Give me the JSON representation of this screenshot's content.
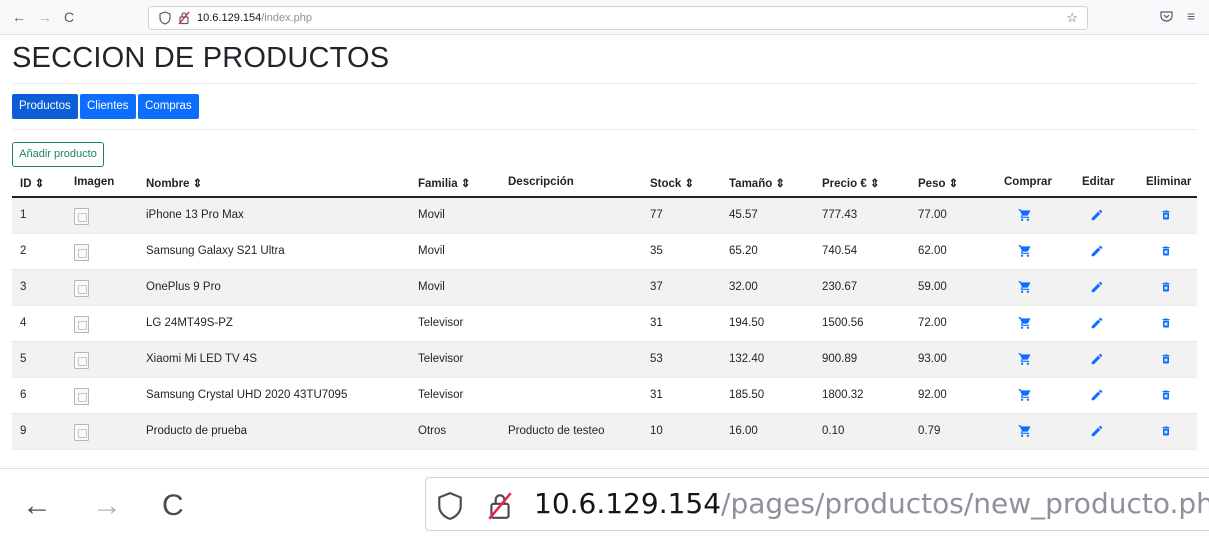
{
  "browser": {
    "back": "←",
    "forward": "→",
    "reload": "C",
    "url_host": "10.6.129.154",
    "url_path": "/index.php",
    "bookmark": "☆",
    "menu": "≡"
  },
  "page": {
    "title": "SECCION DE PRODUCTOS"
  },
  "nav": [
    {
      "label": "Productos",
      "active": true
    },
    {
      "label": "Clientes",
      "active": false
    },
    {
      "label": "Compras",
      "active": false
    }
  ],
  "add_button": "Añadir producto",
  "table": {
    "headers": [
      "ID ⇕",
      "Imagen",
      "Nombre ⇕",
      "Familia ⇕",
      "Descripción",
      "Stock ⇕",
      "Tamaño ⇕",
      "Precio € ⇕",
      "Peso ⇕",
      "Comprar",
      "Editar",
      "Eliminar"
    ],
    "rows": [
      {
        "id": "1",
        "nombre": "iPhone 13 Pro Max",
        "familia": "Movil",
        "descripcion": "",
        "stock": "77",
        "tamano": "45.57",
        "precio": "777.43",
        "peso": "77.00"
      },
      {
        "id": "2",
        "nombre": "Samsung Galaxy S21 Ultra",
        "familia": "Movil",
        "descripcion": "",
        "stock": "35",
        "tamano": "65.20",
        "precio": "740.54",
        "peso": "62.00"
      },
      {
        "id": "3",
        "nombre": "OnePlus 9 Pro",
        "familia": "Movil",
        "descripcion": "",
        "stock": "37",
        "tamano": "32.00",
        "precio": "230.67",
        "peso": "59.00"
      },
      {
        "id": "4",
        "nombre": "LG 24MT49S-PZ",
        "familia": "Televisor",
        "descripcion": "",
        "stock": "31",
        "tamano": "194.50",
        "precio": "1500.56",
        "peso": "72.00"
      },
      {
        "id": "5",
        "nombre": "Xiaomi Mi LED TV 4S",
        "familia": "Televisor",
        "descripcion": "",
        "stock": "53",
        "tamano": "132.40",
        "precio": "900.89",
        "peso": "93.00"
      },
      {
        "id": "6",
        "nombre": "Samsung Crystal UHD 2020 43TU7095",
        "familia": "Televisor",
        "descripcion": "",
        "stock": "31",
        "tamano": "185.50",
        "precio": "1800.32",
        "peso": "92.00"
      },
      {
        "id": "9",
        "nombre": "Producto de prueba",
        "familia": "Otros",
        "descripcion": "Producto de testeo",
        "stock": "10",
        "tamano": "16.00",
        "precio": "0.10",
        "peso": "0.79"
      }
    ]
  },
  "zoom_bar": {
    "back": "←",
    "forward": "→",
    "reload": "C",
    "url_host": "10.6.129.154",
    "url_path": "/pages/productos/new_producto.php"
  },
  "colors": {
    "primary": "#0d6efd",
    "primary_active": "#0b5ed7",
    "success": "#198754"
  },
  "icons": {
    "comprar": "cart-icon",
    "editar": "pencil-icon",
    "eliminar": "trash-icon"
  }
}
